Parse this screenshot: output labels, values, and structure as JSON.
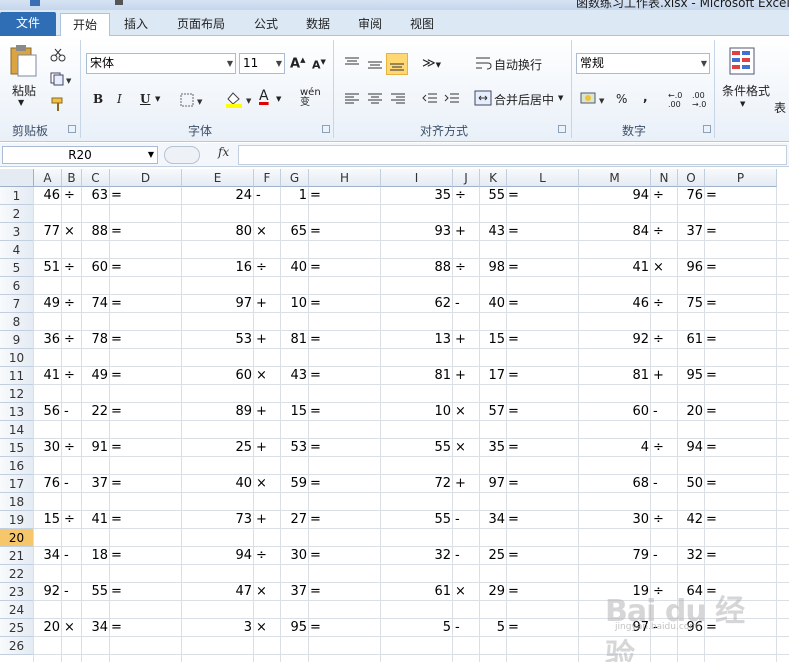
{
  "window": {
    "title": "函数练习工作表.xlsx - Microsoft Excel"
  },
  "tabs": [
    {
      "id": "file",
      "label": "文件"
    },
    {
      "id": "home",
      "label": "开始"
    },
    {
      "id": "insert",
      "label": "插入"
    },
    {
      "id": "layout",
      "label": "页面布局"
    },
    {
      "id": "formulas",
      "label": "公式"
    },
    {
      "id": "data",
      "label": "数据"
    },
    {
      "id": "review",
      "label": "审阅"
    },
    {
      "id": "view",
      "label": "视图"
    }
  ],
  "ribbon": {
    "clipboard": {
      "label": "剪贴板",
      "paste": "粘贴"
    },
    "font": {
      "label": "字体",
      "name": "宋体",
      "size": "11",
      "bold": "B",
      "italic": "I",
      "underline": "U"
    },
    "alignment": {
      "label": "对齐方式",
      "wrap": "自动换行",
      "merge": "合并后居中"
    },
    "number": {
      "label": "数字",
      "format": "常规",
      "percent": "%",
      "comma": ","
    },
    "styles": {
      "conditional": "条件格式",
      "table_partial": "表"
    }
  },
  "formula_bar": {
    "name_box": "R20",
    "fx": "fx",
    "formula": ""
  },
  "grid": {
    "columns": [
      "A",
      "B",
      "C",
      "D",
      "E",
      "F",
      "G",
      "H",
      "I",
      "J",
      "K",
      "L",
      "M",
      "N",
      "O",
      "P"
    ],
    "rows": [
      "1",
      "2",
      "3",
      "4",
      "5",
      "6",
      "7",
      "8",
      "9",
      "10",
      "11",
      "12",
      "13",
      "14",
      "15",
      "16",
      "17",
      "18",
      "19",
      "20",
      "21",
      "22",
      "23",
      "24",
      "25",
      "26"
    ],
    "selected_row": "20",
    "equals": "=",
    "problems": [
      [
        [
          "46",
          "÷",
          "63"
        ],
        [
          "24",
          "-",
          "1"
        ],
        [
          "35",
          "÷",
          "55"
        ],
        [
          "94",
          "÷",
          "76"
        ]
      ],
      [
        [
          "77",
          "×",
          "88"
        ],
        [
          "80",
          "×",
          "65"
        ],
        [
          "93",
          "+",
          "43"
        ],
        [
          "84",
          "÷",
          "37"
        ]
      ],
      [
        [
          "51",
          "÷",
          "60"
        ],
        [
          "16",
          "÷",
          "40"
        ],
        [
          "88",
          "÷",
          "98"
        ],
        [
          "41",
          "×",
          "96"
        ]
      ],
      [
        [
          "49",
          "÷",
          "74"
        ],
        [
          "97",
          "+",
          "10"
        ],
        [
          "62",
          "-",
          "40"
        ],
        [
          "46",
          "÷",
          "75"
        ]
      ],
      [
        [
          "36",
          "÷",
          "78"
        ],
        [
          "53",
          "+",
          "81"
        ],
        [
          "13",
          "+",
          "15"
        ],
        [
          "92",
          "÷",
          "61"
        ]
      ],
      [
        [
          "41",
          "÷",
          "49"
        ],
        [
          "60",
          "×",
          "43"
        ],
        [
          "81",
          "+",
          "17"
        ],
        [
          "81",
          "+",
          "95"
        ]
      ],
      [
        [
          "56",
          "-",
          "22"
        ],
        [
          "89",
          "+",
          "15"
        ],
        [
          "10",
          "×",
          "57"
        ],
        [
          "60",
          "-",
          "20"
        ]
      ],
      [
        [
          "30",
          "÷",
          "91"
        ],
        [
          "25",
          "+",
          "53"
        ],
        [
          "55",
          "×",
          "35"
        ],
        [
          "4",
          "÷",
          "94"
        ]
      ],
      [
        [
          "76",
          "-",
          "37"
        ],
        [
          "40",
          "×",
          "59"
        ],
        [
          "72",
          "+",
          "97"
        ],
        [
          "68",
          "-",
          "50"
        ]
      ],
      [
        [
          "15",
          "÷",
          "41"
        ],
        [
          "73",
          "+",
          "27"
        ],
        [
          "55",
          "-",
          "34"
        ],
        [
          "30",
          "÷",
          "42"
        ]
      ],
      [
        [
          "34",
          "-",
          "18"
        ],
        [
          "94",
          "÷",
          "30"
        ],
        [
          "32",
          "-",
          "25"
        ],
        [
          "79",
          "-",
          "32"
        ]
      ],
      [
        [
          "92",
          "-",
          "55"
        ],
        [
          "47",
          "×",
          "37"
        ],
        [
          "61",
          "×",
          "29"
        ],
        [
          "19",
          "÷",
          "64"
        ]
      ],
      [
        [
          "20",
          "×",
          "34"
        ],
        [
          "3",
          "×",
          "95"
        ],
        [
          "5",
          "-",
          "5"
        ],
        [
          "97",
          "-",
          "96"
        ]
      ]
    ]
  },
  "watermark": {
    "text": "Bai du 经验",
    "sub": "jingyan.baidu.com"
  }
}
